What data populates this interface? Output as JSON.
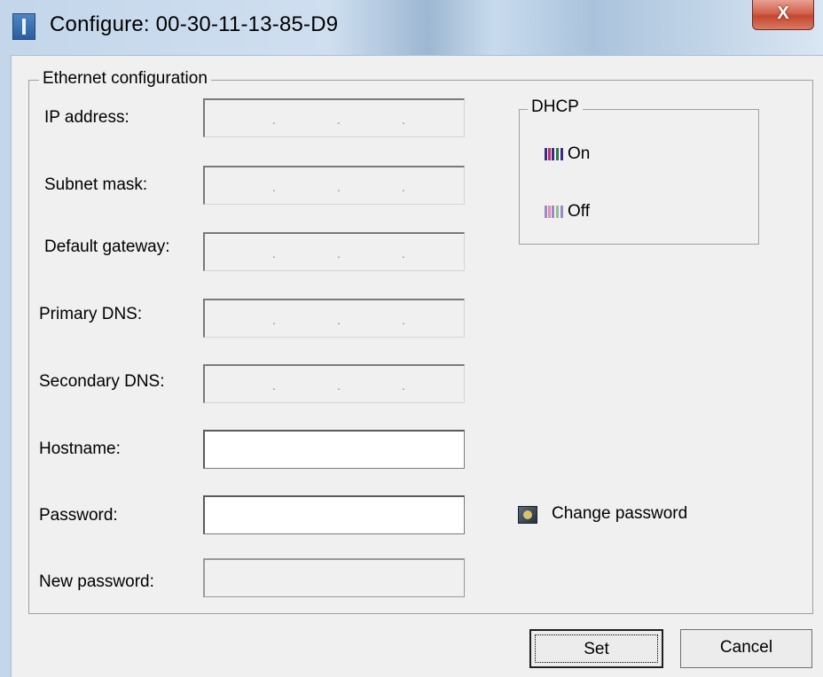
{
  "window": {
    "title": "Configure: 00-30-11-13-85-D9",
    "close_label": "X"
  },
  "ethernet": {
    "group_title": "Ethernet configuration",
    "fields": {
      "ip_address": {
        "label": "IP address:",
        "dots": ".  .  ."
      },
      "subnet_mask": {
        "label": "Subnet mask:"
      },
      "default_gateway": {
        "label": "Default gateway:"
      },
      "primary_dns": {
        "label": "Primary DNS:"
      },
      "secondary_dns": {
        "label": "Secondary DNS:"
      },
      "hostname": {
        "label": "Hostname:",
        "value": ""
      },
      "password": {
        "label": "Password:",
        "value": ""
      },
      "new_password": {
        "label": "New password:",
        "value": ""
      }
    },
    "ip_dot": "."
  },
  "dhcp": {
    "group_title": "DHCP",
    "on_label": "On",
    "off_label": "Off",
    "colors": {
      "on_icon": [
        "#3a2a8a",
        "#c03060",
        "#2a7a3a"
      ],
      "off_icon": [
        "#9a8ac8",
        "#e090b0",
        "#90c090"
      ]
    }
  },
  "change_password_label": "Change password",
  "buttons": {
    "set_label": "Set",
    "cancel_label": "Cancel"
  },
  "icons": {
    "app": "app-icon",
    "close": "close-icon",
    "dhcp_on": "network-on-icon",
    "dhcp_off": "network-off-icon",
    "change_password": "key-icon"
  }
}
